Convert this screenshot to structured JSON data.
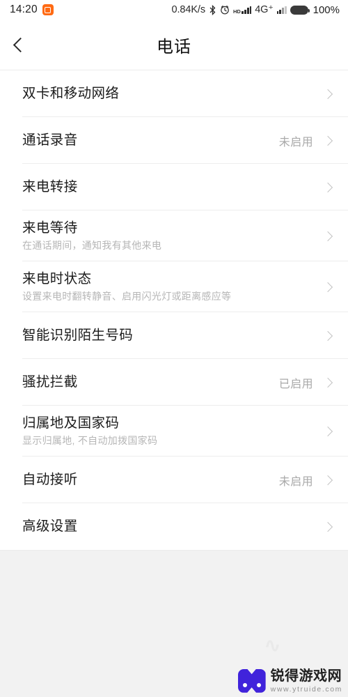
{
  "statusbar": {
    "time": "14:20",
    "app_icon": "screen-recorder-icon",
    "network_speed": "0.84K/s",
    "bluetooth_icon": "bluetooth-icon",
    "alarm_icon": "alarm-clock-icon",
    "hd_label": "HD",
    "signal_sim1_icon": "signal-bars-icon",
    "network_type": "4G⁺",
    "signal_sim2_icon": "signal-bars-icon",
    "battery_icon": "battery-full-icon",
    "battery_percent": "100%"
  },
  "header": {
    "back_icon": "back-chevron-icon",
    "title": "电话"
  },
  "settings": {
    "rows": [
      {
        "title": "双卡和移动网络",
        "sub": "",
        "value": ""
      },
      {
        "title": "通话录音",
        "sub": "",
        "value": "未启用"
      },
      {
        "title": "来电转接",
        "sub": "",
        "value": ""
      },
      {
        "title": "来电等待",
        "sub": "在通话期间，通知我有其他来电",
        "value": ""
      },
      {
        "title": "来电时状态",
        "sub": "设置来电时翻转静音、启用闪光灯或距离感应等",
        "value": ""
      },
      {
        "title": "智能识别陌生号码",
        "sub": "",
        "value": ""
      },
      {
        "title": "骚扰拦截",
        "sub": "",
        "value": "已启用"
      },
      {
        "title": "归属地及国家码",
        "sub": "显示归属地, 不自动加拨国家码",
        "value": ""
      },
      {
        "title": "自动接听",
        "sub": "",
        "value": "未启用"
      },
      {
        "title": "高级设置",
        "sub": "",
        "value": ""
      }
    ]
  },
  "watermark": {
    "logo_icon": "gamepad-logo-icon",
    "name": "锐得游戏网",
    "url": "www.ytruide.com"
  },
  "colors": {
    "page_background": "#f2f2f2",
    "panel": "#ffffff",
    "title_text": "#111111",
    "value_text": "#a9a9a9",
    "sub_text": "#b6b6b6",
    "divider": "#ededed",
    "chevron": "#c4c4c4",
    "app_icon_orange": "#ff6a13",
    "watermark_logo": "#3b1ddb"
  }
}
